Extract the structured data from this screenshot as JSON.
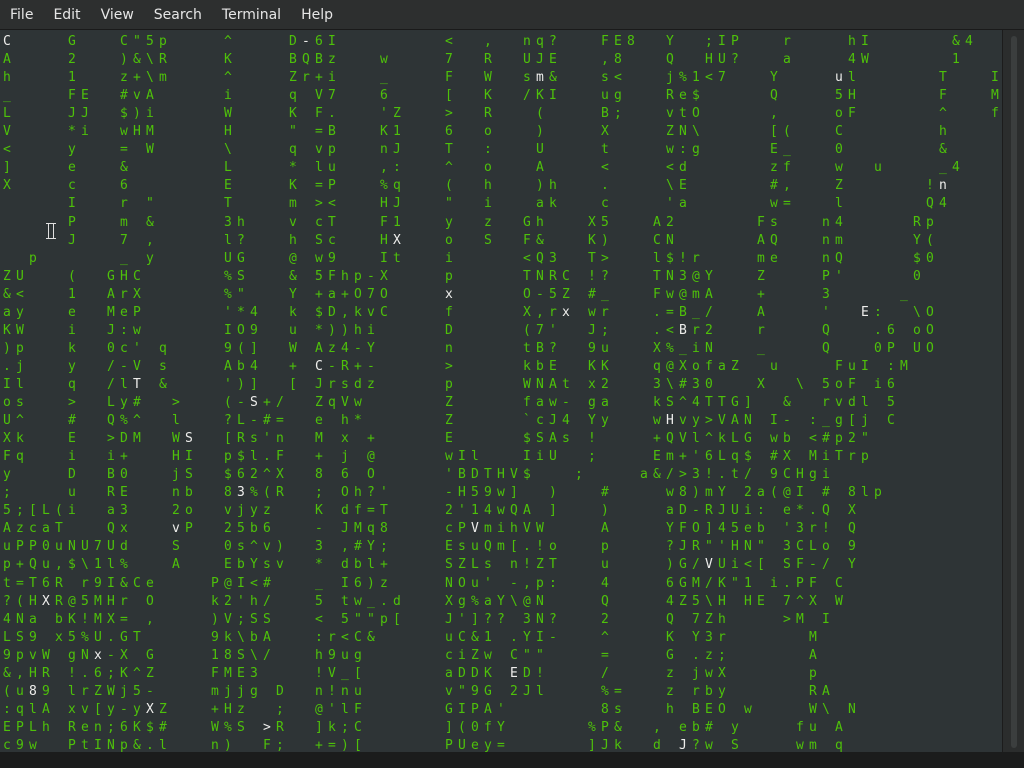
{
  "window": {
    "menu": [
      "File",
      "Edit",
      "View",
      "Search",
      "Terminal",
      "Help"
    ]
  },
  "colors": {
    "terminal_background": "#2e3436",
    "rain_green": "#4ec10a",
    "rain_head_white": "#eeeeec",
    "menubar": "#2d2f2f"
  },
  "terminal": {
    "program_output_style": "matrix digital rain",
    "lines": [
      "C    G   C\"5p    ^    D-6I        <  ,  nq?   FE8  Y  ;IP   r    hI      &4  I",
      "A    2   )&\\R    K    BQBz   w    7  R  UJE   ,8   Q  HU?   a    4W      1   \\",
      "h    1   z+\\m    ^    Zr+i   _    F  W  sm&   s<   j%1<7   Y    ul      T   I",
      "_    FE  #vA     i    q V7   6    [  K  /KI   ug   Re$     Q    5H      F   M",
      "L    JJ  $)i     W    K F.   'Z   >  R   (    B;   vtO     ,    oF      ^   f",
      "V    *i  wHM     H    \" =B   K1   6  o   )    X    ZN\\     [(   C       h",
      "<    y   = W     \\    q vp   nJ   T  :   U    t    w:g     E_   0       &",
      "]    e   &       L    * lu   ,:   ^  o   A    <    <d      zf   w  u    _4",
      "X    c   6       E    K =P   %q   (  h   )h   .    \\E      #,   Z      !n",
      "     I   r \"     T    m ><   HJ   \"  i   ak   c    'a      w=   l      Q4",
      "     P   m &     3h   v cT   F1   y  z  Gh   X5   A2      Fs   n4     Rp",
      "     J   7 ,     l?   h Sc   HX   o  S  F&   K)   CN      AQ   nm     Y(",
      "  p      _ y     UG   @ w9   It   i     <Q3  T>   l$!r    me   nQ     $0",
      "ZU   (  GHC      %S   & 5Fhp-X    p     TNRC !?   TN3@Y   Z    P'     0",
      "&<   1  ArX      %\"   Y +a+O7O    x     O-5Z #_   Fw@mA   +    3     _",
      "ay   e  MeP      '*4  k $D,kvC    f     X,rx wr   .=B_/   A    '  E:  \\O",
      "KW   i  J:w      IO9  u *))hi     D     (7'  J;   .<Br2   r    Q   .6 oO",
      ")p   k  0c' q    9(]  W Az4-Y     n     tB?  9u   X%_iN   _    Q   0P UO",
      ".j   y  /-V s    Ab4  + C-R+-     >     kbE  KK   q@XofaZ  u    FuI :M",
      "Il   q  /lT &    ')]  [ Jrsdz     p     WNAt x2   3\\#30   X  \\ 5oF i6",
      "os   >  Ly#  >   (-S+/  ZqVw      Z     faw- ga   kS^4TTG]  &  rvdl 5",
      "U^   #  Q%^  l   ?L-#=  e h*      Z     `cJ4 Yy   wHvy>VAN I- :_g[j C",
      "Xk   E  >DM  WS  [Rs'n  M x +     E     $SAs !    +QVl^kLG wb <#p2\"",
      "Fq   i  i+   HI  p$l.F  + j @     wIl   IiU  ;    Em+'6Lq$ #X MiTrp",
      "y    D  B0   jS  $62^X  8 6 O     'BDTHV$   ;    a&/>3!.t/ 9CHgi",
      ";    u  RE   nb  83%(R  ; Oh?'    -H59w]  )   #    w8)mY 2a(@I # 8lp",
      "5;[L(i  a3   2o  vjyz   K df=T    2'14wQA ]   )    aD-RJUi: e*.Q X",
      "AzcaT   Qx   vP  25b6   - JMq8    cPVmihVW    A    YFO]45eb '3r! Q",
      "uPP0uNU7Ud   S   0s^v)  3 ,#Y;    EsuQm[.!o   p    ?JR\"'HN\" 3CLo 9",
      "p+Qu,$\\1l%   A   EbYsv  * dbl+    SZLs n!ZT   u    )G/VUi<[ SF-/ Y",
      "t=T6R r9I&Ce    P@I<#   _ I6)z    NOu' -,p:   4    6GM/K\"1 i.PF C",
      "?(HXR@5MHr O    k2'h/   5 tw_.d   Xg%aY\\@N    Q    4Z5\\H HE 7^X W",
      "4Na bK!MX= ,    )V;SS   < 5\"\"p[   J']?? 3N?   2    Q 7Zh    >M I",
      "LS9 x5%U.GT     9k\\bA   :r<C&     uC&1 .YI-   ^    K Y3r      M",
      "9pvW gNx-X G    18S\\/   h9ug      ciZw C\"\"    =    G .z;      A",
      "&,HR !.6;K^Z    FME3    !V_[      aDDK ED!    /    z jwX      p",
      "(u89 lrZWj5-    mjjg D  n!nu      v\"9G 2Jl    %=   z rby      RA",
      ":qlA xv[y-yXZ   +Hz  ;  @'lF      GIPA'       8s   h BEO w    W\\ N",
      "EPLh Ren;6K$#   W%S >R  ]k;C      ](0fY      %P&  , eb# y    fu A",
      "c9w  PtINp&.l   n)  F;  +=)[      PUey=      ]Jk  d J?w S    wm q"
    ]
  }
}
